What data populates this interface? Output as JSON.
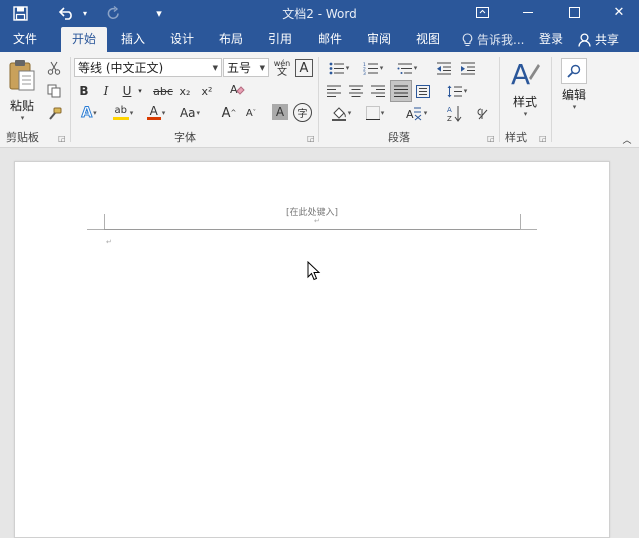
{
  "window": {
    "title": "文档2 - Word",
    "restore_glyph": "⧉",
    "minimize_glyph": "—",
    "maximize_glyph": "☐",
    "close_glyph": "✕"
  },
  "quick_access": {
    "save_icon": "save-icon",
    "undo_icon": "undo-icon",
    "redo_icon": "redo-icon",
    "customize_glyph": "▾"
  },
  "tabs": [
    {
      "label": "文件"
    },
    {
      "label": "开始"
    },
    {
      "label": "插入"
    },
    {
      "label": "设计"
    },
    {
      "label": "布局"
    },
    {
      "label": "引用"
    },
    {
      "label": "邮件"
    },
    {
      "label": "审阅"
    },
    {
      "label": "视图"
    }
  ],
  "active_tab": "开始",
  "tell_me": {
    "text": "告诉我..."
  },
  "account": {
    "login": "登录",
    "share": "共享"
  },
  "ribbon": {
    "clipboard": {
      "label": "剪贴板",
      "paste": "粘贴"
    },
    "font": {
      "label": "字体",
      "font_name": "等线 (中文正文)",
      "font_size": "五号",
      "phonetic_top": "wén",
      "phonetic_bottom": "文",
      "border_char": "A",
      "bold": "B",
      "italic": "I",
      "underline": "U",
      "strike": "abc",
      "subscript": "x₂",
      "superscript": "x²",
      "effects": "A",
      "highlight": "ab",
      "font_color": "A",
      "change_case": "Aa",
      "grow": "A",
      "shrink": "A",
      "shading_char": "A",
      "enclose_char": "字"
    },
    "paragraph": {
      "label": "段落"
    },
    "styles": {
      "label": "样式",
      "button": "样式"
    },
    "editing": {
      "button": "编辑"
    }
  },
  "document": {
    "header_placeholder": "[在此处键入]"
  },
  "colors": {
    "brand": "#2b579a",
    "highlight_yellow": "#ffd400",
    "font_color_red": "#d83b01"
  }
}
